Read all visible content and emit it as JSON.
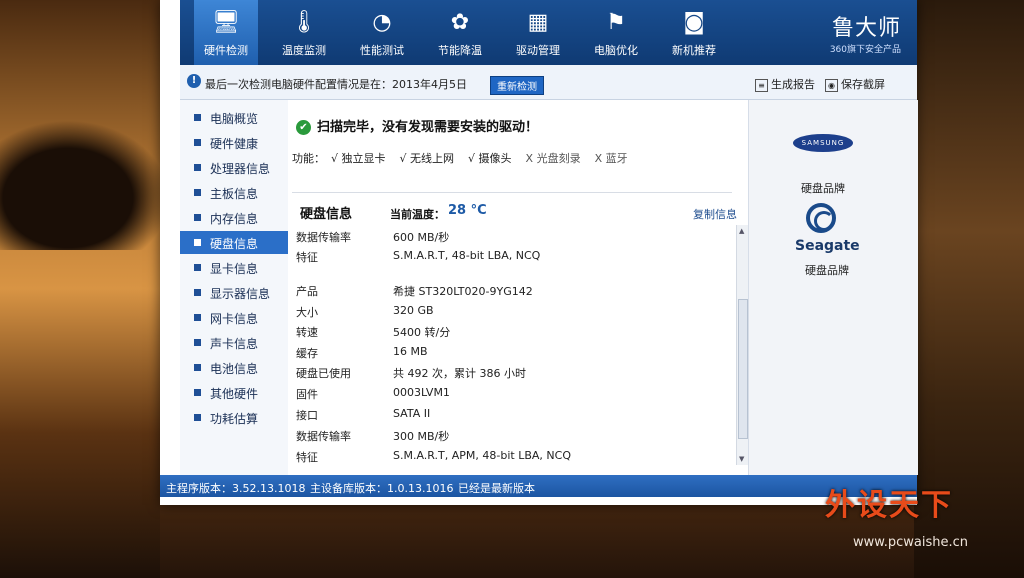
{
  "toolbar": {
    "items": [
      {
        "label": "硬件检测",
        "icon": "monitor-icon",
        "glyph": "🖥",
        "active": true
      },
      {
        "label": "温度监测",
        "icon": "thermometer-icon",
        "glyph": "🌡",
        "active": false
      },
      {
        "label": "性能测试",
        "icon": "gauge-icon",
        "glyph": "◔",
        "active": false
      },
      {
        "label": "节能降温",
        "icon": "leaf-icon",
        "glyph": "✿",
        "active": false
      },
      {
        "label": "驱动管理",
        "icon": "chip-icon",
        "glyph": "▦",
        "active": false
      },
      {
        "label": "电脑优化",
        "icon": "optimize-icon",
        "glyph": "⚑",
        "active": false
      },
      {
        "label": "新机推荐",
        "icon": "new-pc-icon",
        "glyph": "◙",
        "active": false
      }
    ],
    "brand_name": "鲁大师",
    "brand_sub": "360旗下安全产品"
  },
  "infobar": {
    "text": "最后一次检测电脑硬件配置情况是在：2013年4月5日",
    "rescan_label": "重新检测",
    "report_label": "生成报告",
    "save_label": "保存截屏"
  },
  "sidebar": {
    "items": [
      {
        "label": "电脑概览"
      },
      {
        "label": "硬件健康"
      },
      {
        "label": "处理器信息"
      },
      {
        "label": "主板信息"
      },
      {
        "label": "内存信息"
      },
      {
        "label": "硬盘信息"
      },
      {
        "label": "显卡信息"
      },
      {
        "label": "显示器信息"
      },
      {
        "label": "网卡信息"
      },
      {
        "label": "声卡信息"
      },
      {
        "label": "电池信息"
      },
      {
        "label": "其他硬件"
      },
      {
        "label": "功耗估算"
      }
    ],
    "active_index": 5
  },
  "content": {
    "scan_message": "扫描完毕，没有发现需要安装的驱动！",
    "func_label": "功能：",
    "features": [
      {
        "text": "√ 独立显卡",
        "ok": true
      },
      {
        "text": "√ 无线上网",
        "ok": true
      },
      {
        "text": "√ 摄像头",
        "ok": true
      },
      {
        "text": "X 光盘刻录",
        "ok": false
      },
      {
        "text": "X 蓝牙",
        "ok": false
      }
    ],
    "section_title": "硬盘信息",
    "temp_label": "当前温度：",
    "temp_value": "28 °C",
    "copy_label": "复制信息",
    "rows": [
      {
        "k": "数据传输率",
        "v": "600 MB/秒"
      },
      {
        "k": "特征",
        "v": "S.M.A.R.T,  48-bit LBA,  NCQ"
      },
      {
        "k": "产品",
        "v": "希捷 ST320LT020-9YG142"
      },
      {
        "k": "大小",
        "v": "320 GB"
      },
      {
        "k": "转速",
        "v": "5400 转/分"
      },
      {
        "k": "缓存",
        "v": "16 MB"
      },
      {
        "k": "硬盘已使用",
        "v": "共 492 次，累计 386 小时"
      },
      {
        "k": "固件",
        "v": "0003LVM1"
      },
      {
        "k": "接口",
        "v": "SATA II"
      },
      {
        "k": "数据传输率",
        "v": "300 MB/秒"
      },
      {
        "k": "特征",
        "v": "S.M.A.R.T,  APM,  48-bit LBA,  NCQ"
      }
    ]
  },
  "right_panel": {
    "samsung_text": "SAMSUNG",
    "brand_label_1": "硬盘品牌",
    "seagate_text": "Seagate",
    "brand_label_2": "硬盘品牌"
  },
  "statusbar": {
    "main_version": "主程序版本：3.52.13.1018",
    "db_version": "主设备库版本：1.0.13.1016",
    "latest": "已经是最新版本"
  },
  "watermark": {
    "logo": "外设天下",
    "url": "www.pcwaishe.cn"
  }
}
